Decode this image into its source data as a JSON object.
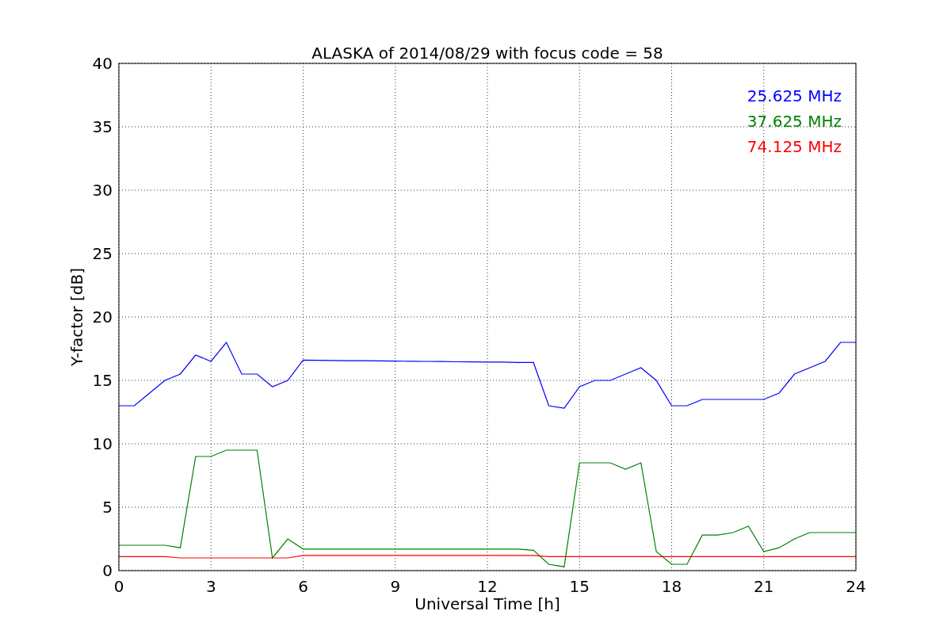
{
  "chart_data": {
    "type": "line",
    "title": "ALASKA of 2014/08/29 with focus code = 58",
    "xlabel": "Universal Time [h]",
    "ylabel": "Y-factor [dB]",
    "x": [
      0,
      0.5,
      1,
      1.5,
      2,
      2.5,
      3,
      3.5,
      4,
      4.5,
      5,
      5.5,
      6,
      6.5,
      7,
      7.5,
      8,
      8.5,
      9,
      9.5,
      10,
      10.5,
      11,
      11.5,
      12,
      12.5,
      13,
      13.5,
      14,
      14.5,
      15,
      15.5,
      16,
      16.5,
      17,
      17.5,
      18,
      18.5,
      19,
      19.5,
      20,
      20.5,
      21,
      21.5,
      22,
      22.5,
      23,
      23.5,
      24
    ],
    "series": [
      {
        "name": "25.625 MHz",
        "color": "#0000ff",
        "values": [
          13,
          13,
          14,
          15,
          15.5,
          17,
          16.5,
          18,
          15.5,
          15.5,
          14.5,
          15,
          16.6,
          16.59,
          16.57,
          16.56,
          16.55,
          16.54,
          16.52,
          16.51,
          16.5,
          16.49,
          16.47,
          16.46,
          16.45,
          16.44,
          16.42,
          16.41,
          13,
          12.8,
          14.5,
          15,
          15,
          15.5,
          16,
          15,
          13,
          13,
          13.5,
          13.5,
          13.5,
          13.5,
          13.5,
          14,
          15.5,
          16,
          16.5,
          18,
          18
        ]
      },
      {
        "name": "37.625 MHz",
        "color": "#008000",
        "values": [
          2,
          2,
          2,
          2,
          1.8,
          9,
          9,
          9.5,
          9.5,
          9.5,
          1,
          2.5,
          1.7,
          1.7,
          1.7,
          1.7,
          1.7,
          1.7,
          1.7,
          1.7,
          1.7,
          1.7,
          1.7,
          1.7,
          1.7,
          1.7,
          1.7,
          1.6,
          0.5,
          0.3,
          8.5,
          8.5,
          8.5,
          8,
          8.5,
          1.5,
          0.5,
          0.5,
          2.8,
          2.8,
          3,
          3.5,
          1.5,
          1.8,
          2.5,
          3,
          3,
          3,
          3
        ]
      },
      {
        "name": "74.125 MHz",
        "color": "#ff0000",
        "values": [
          1.1,
          1.1,
          1.1,
          1.1,
          1,
          1,
          1,
          1,
          1,
          1,
          1,
          1,
          1.2,
          1.2,
          1.2,
          1.2,
          1.2,
          1.2,
          1.2,
          1.2,
          1.2,
          1.2,
          1.2,
          1.2,
          1.2,
          1.2,
          1.2,
          1.2,
          1.1,
          1.1,
          1.1,
          1.1,
          1.1,
          1.1,
          1.1,
          1.1,
          1.1,
          1.1,
          1.1,
          1.1,
          1.1,
          1.1,
          1.1,
          1.1,
          1.1,
          1.1,
          1.1,
          1.1,
          1.1
        ]
      }
    ],
    "grid": true,
    "xlim": [
      0,
      24
    ],
    "ylim": [
      0,
      40
    ],
    "xticks": [
      0,
      3,
      6,
      9,
      12,
      15,
      18,
      21,
      24
    ],
    "yticks": [
      0,
      5,
      10,
      15,
      20,
      25,
      30,
      35,
      40
    ]
  }
}
